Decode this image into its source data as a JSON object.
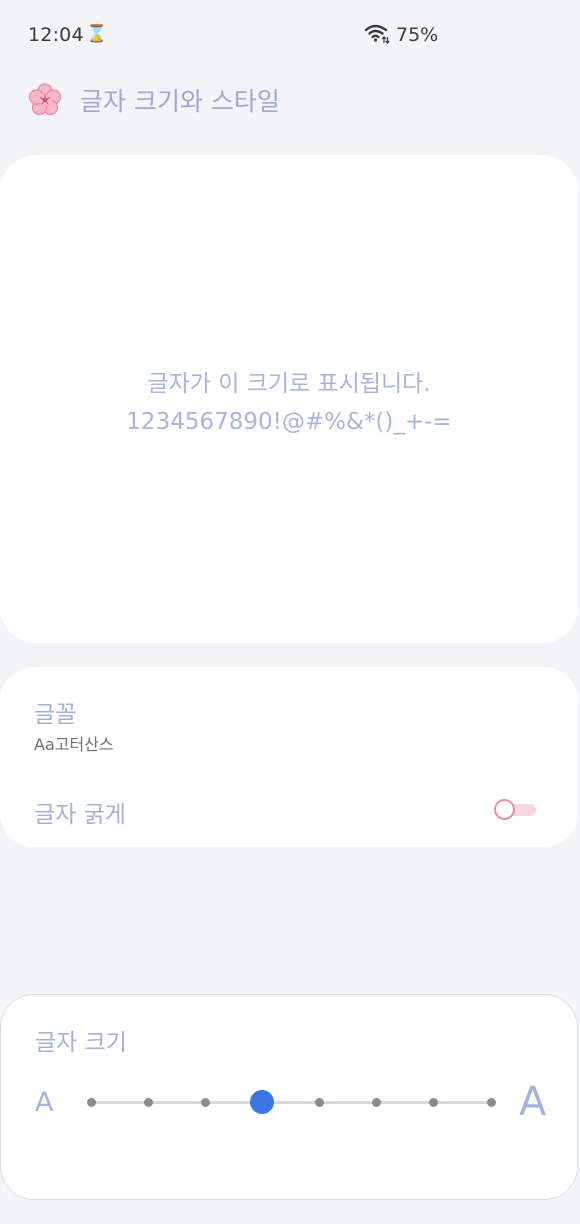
{
  "status_bar": {
    "time": "12:04",
    "hourglass_icon": "⌛",
    "battery": "75%"
  },
  "header": {
    "title": "글자 크기와 스타일",
    "icon": "flower-icon"
  },
  "preview": {
    "line1": "글자가 이 크기로 표시됩니다.",
    "line2": "1234567890!@#%&*()_+-="
  },
  "settings": {
    "font_label": "글꼴",
    "font_value": "Aa고터산스",
    "bold_label": "글자 굵게",
    "bold_enabled": false
  },
  "font_size": {
    "label": "글자 크기",
    "small_glyph": "A",
    "large_glyph": "A",
    "steps": 8,
    "selected_step": 4,
    "accent_color": "#3b77e4"
  }
}
